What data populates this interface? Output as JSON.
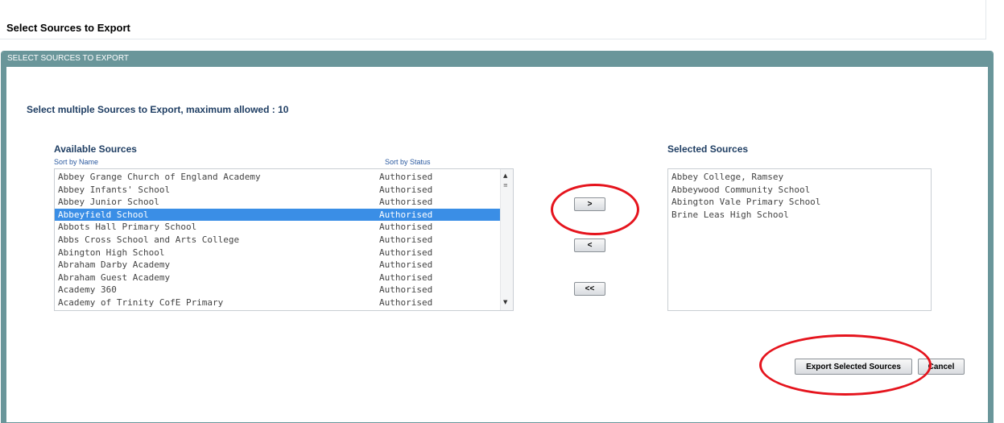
{
  "page": {
    "title": "Select Sources to Export"
  },
  "panel": {
    "header": "SELECT SOURCES TO EXPORT",
    "instruction": "Select multiple Sources to Export, maximum allowed : 10"
  },
  "available": {
    "heading": "Available Sources",
    "sort_by_name": "Sort by Name",
    "sort_by_status": "Sort by Status",
    "rows": [
      {
        "name": "Abbey Grange Church of England Academy",
        "status": "Authorised"
      },
      {
        "name": "Abbey Infants' School",
        "status": "Authorised"
      },
      {
        "name": "Abbey Junior School",
        "status": "Authorised"
      },
      {
        "name": "Abbeyfield School",
        "status": "Authorised",
        "selected": true
      },
      {
        "name": "Abbots Hall Primary School",
        "status": "Authorised"
      },
      {
        "name": "Abbs Cross School and Arts College",
        "status": "Authorised"
      },
      {
        "name": "Abington High School",
        "status": "Authorised"
      },
      {
        "name": "Abraham Darby Academy",
        "status": "Authorised"
      },
      {
        "name": "Abraham Guest Academy",
        "status": "Authorised"
      },
      {
        "name": "Academy 360",
        "status": "Authorised"
      },
      {
        "name": "Academy of Trinity CofE Primary",
        "status": "Authorised"
      }
    ]
  },
  "controls": {
    "add_label": ">",
    "remove_label": "<",
    "remove_all_label": "<<"
  },
  "selected": {
    "heading": "Selected Sources",
    "rows": [
      "Abbey College, Ramsey",
      "Abbeywood Community School",
      "Abington Vale Primary School",
      "Brine Leas High School"
    ]
  },
  "actions": {
    "export_label": "Export Selected Sources",
    "cancel_label": "Cancel"
  },
  "colors": {
    "panel_header": "#6a969a",
    "selected_row": "#3a8ee6",
    "heading_text": "#1f3e63",
    "annotation": "#e5141d"
  }
}
